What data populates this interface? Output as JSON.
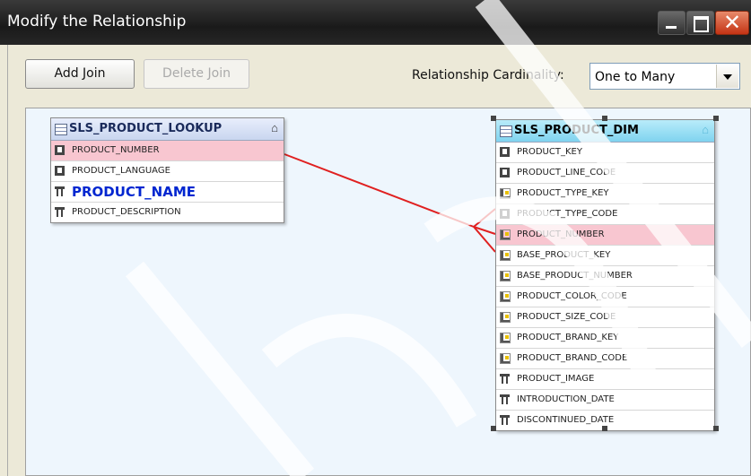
{
  "window": {
    "title": "Modify the Relationship"
  },
  "toolbar": {
    "add_join": "Add Join",
    "delete_join": "Delete Join"
  },
  "cardinality": {
    "label": "Relationship Cardinality:",
    "value": "One to Many"
  },
  "lookup_table": {
    "name": "SLS_PRODUCT_LOOKUP",
    "columns": [
      {
        "name": "PRODUCT_NUMBER",
        "icon": "key-column-icon",
        "highlighted": true
      },
      {
        "name": "PRODUCT_LANGUAGE",
        "icon": "key-column-icon"
      },
      {
        "name": "PRODUCT_NAME",
        "icon": "text-column-icon",
        "bold": true
      },
      {
        "name": "PRODUCT_DESCRIPTION",
        "icon": "text-column-icon"
      }
    ]
  },
  "dim_table": {
    "name": "SLS_PRODUCT_DIM",
    "columns": [
      {
        "name": "PRODUCT_KEY",
        "icon": "key-column-icon"
      },
      {
        "name": "PRODUCT_LINE_CODE",
        "icon": "key-column-icon"
      },
      {
        "name": "PRODUCT_TYPE_KEY",
        "icon": "measure-column-icon"
      },
      {
        "name": "PRODUCT_TYPE_CODE",
        "icon": "key-column-icon"
      },
      {
        "name": "PRODUCT_NUMBER",
        "icon": "measure-column-icon",
        "highlighted": true
      },
      {
        "name": "BASE_PRODUCT_KEY",
        "icon": "measure-column-icon"
      },
      {
        "name": "BASE_PRODUCT_NUMBER",
        "icon": "measure-column-icon"
      },
      {
        "name": "PRODUCT_COLOR_CODE",
        "icon": "measure-column-icon"
      },
      {
        "name": "PRODUCT_SIZE_CODE",
        "icon": "measure-column-icon"
      },
      {
        "name": "PRODUCT_BRAND_KEY",
        "icon": "measure-column-icon"
      },
      {
        "name": "PRODUCT_BRAND_CODE",
        "icon": "measure-column-icon"
      },
      {
        "name": "PRODUCT_IMAGE",
        "icon": "text-column-icon"
      },
      {
        "name": "INTRODUCTION_DATE",
        "icon": "text-column-icon"
      },
      {
        "name": "DISCONTINUED_DATE",
        "icon": "text-column-icon"
      }
    ]
  },
  "colors": {
    "join_line": "#e02020",
    "highlight_row": "#f8c6d0",
    "canvas": "#eef6fd",
    "accent_name": "#0026d0"
  }
}
